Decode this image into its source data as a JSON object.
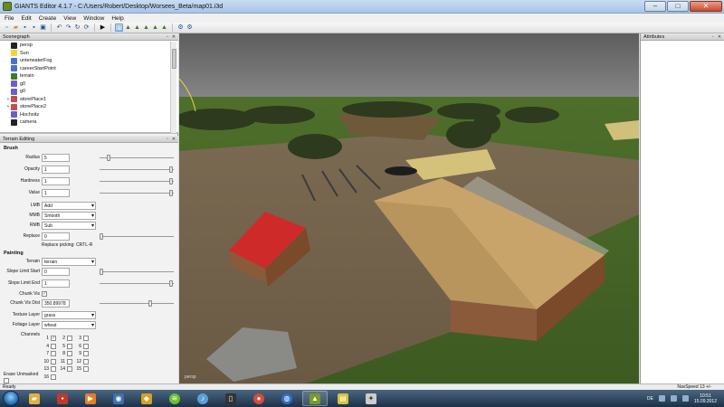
{
  "window": {
    "title": "GIANTS Editor 4.1.7 - C:/Users/Robert/Desktop/Worsees_Beta/map01.i3d",
    "minimize": "–",
    "maximize": "□",
    "close": "✕"
  },
  "menu": [
    "File",
    "Edit",
    "Create",
    "View",
    "Window",
    "Help"
  ],
  "scenegraph": {
    "title": "Scenegraph",
    "items": [
      {
        "label": "persp",
        "icon": "camera-icon",
        "color": "#222222",
        "expand": ""
      },
      {
        "label": "Sun",
        "icon": "light-icon",
        "color": "#f2d43a",
        "expand": ""
      },
      {
        "label": "unterwaterFog",
        "icon": "transform-icon",
        "color": "#4a6fd1",
        "expand": ""
      },
      {
        "label": "careerStartPoint",
        "icon": "transform-icon",
        "color": "#4a6fd1",
        "expand": ""
      },
      {
        "label": "terrain",
        "icon": "terrain-icon",
        "color": "#3f7a2a",
        "expand": ""
      },
      {
        "label": "g0",
        "icon": "shape-icon",
        "color": "#6d5fc7",
        "expand": ""
      },
      {
        "label": "g0",
        "icon": "shape-icon",
        "color": "#6d5fc7",
        "expand": ""
      },
      {
        "label": "storePlace1",
        "icon": "group-icon",
        "color": "#c0504d",
        "expand": "+"
      },
      {
        "label": "storePlace2",
        "icon": "group-icon",
        "color": "#c0504d",
        "expand": "+"
      },
      {
        "label": "Hochsitz",
        "icon": "shape-icon",
        "color": "#6d5fc7",
        "expand": ""
      },
      {
        "label": "camera",
        "icon": "camera-icon",
        "color": "#222222",
        "expand": ""
      }
    ]
  },
  "terrain_editing": {
    "title": "Terrain Editing",
    "brush_label": "Brush",
    "radius_label": "Radius",
    "radius_value": "5",
    "opacity_label": "Opacity",
    "opacity_value": "1",
    "hardness_label": "Hardness",
    "hardness_value": "1",
    "value_label": "Value",
    "value_value": "1",
    "lmb_label": "LMB",
    "lmb_value": "Add",
    "mmb_label": "MMB",
    "mmb_value": "Smooth",
    "rmb_label": "RMB",
    "rmb_value": "Sub",
    "replace_label": "Replace",
    "replace_value": "0",
    "replace_note": "Replace picking: CRTL-R",
    "painting_label": "Painting",
    "terrain_label": "Terrain",
    "terrain_value": "terrain",
    "slope_start_label": "Slope Limit Start",
    "slope_start_value": "0",
    "slope_end_label": "Slope Limit End",
    "slope_end_value": "1",
    "chunk_vis_label": "Chunk Vis",
    "chunk_vis_checked": "✓",
    "chunk_vis_dist_label": "Chunk Vis Dist",
    "chunk_vis_dist_value": "350.89978",
    "texture_layer_label": "Texture Layer",
    "texture_layer_value": "grass",
    "foliage_layer_label": "Foliage Layer",
    "foliage_layer_value": "wheat",
    "channels_label": "Channels",
    "channel_numbers": [
      "1",
      "2",
      "3",
      "4",
      "5",
      "6",
      "7",
      "8",
      "9",
      "10",
      "11",
      "12",
      "13",
      "14",
      "15",
      "16"
    ],
    "erase_label": "Erase Unmasked"
  },
  "attributes": {
    "title": "Attributes"
  },
  "status": {
    "left": "Ready",
    "right": "NavSpeed 13 +/-"
  },
  "taskbar": {
    "lang": "DE",
    "time": "10:51",
    "date": "15.09.2012"
  },
  "viewport": {
    "camera_label": "persp"
  }
}
